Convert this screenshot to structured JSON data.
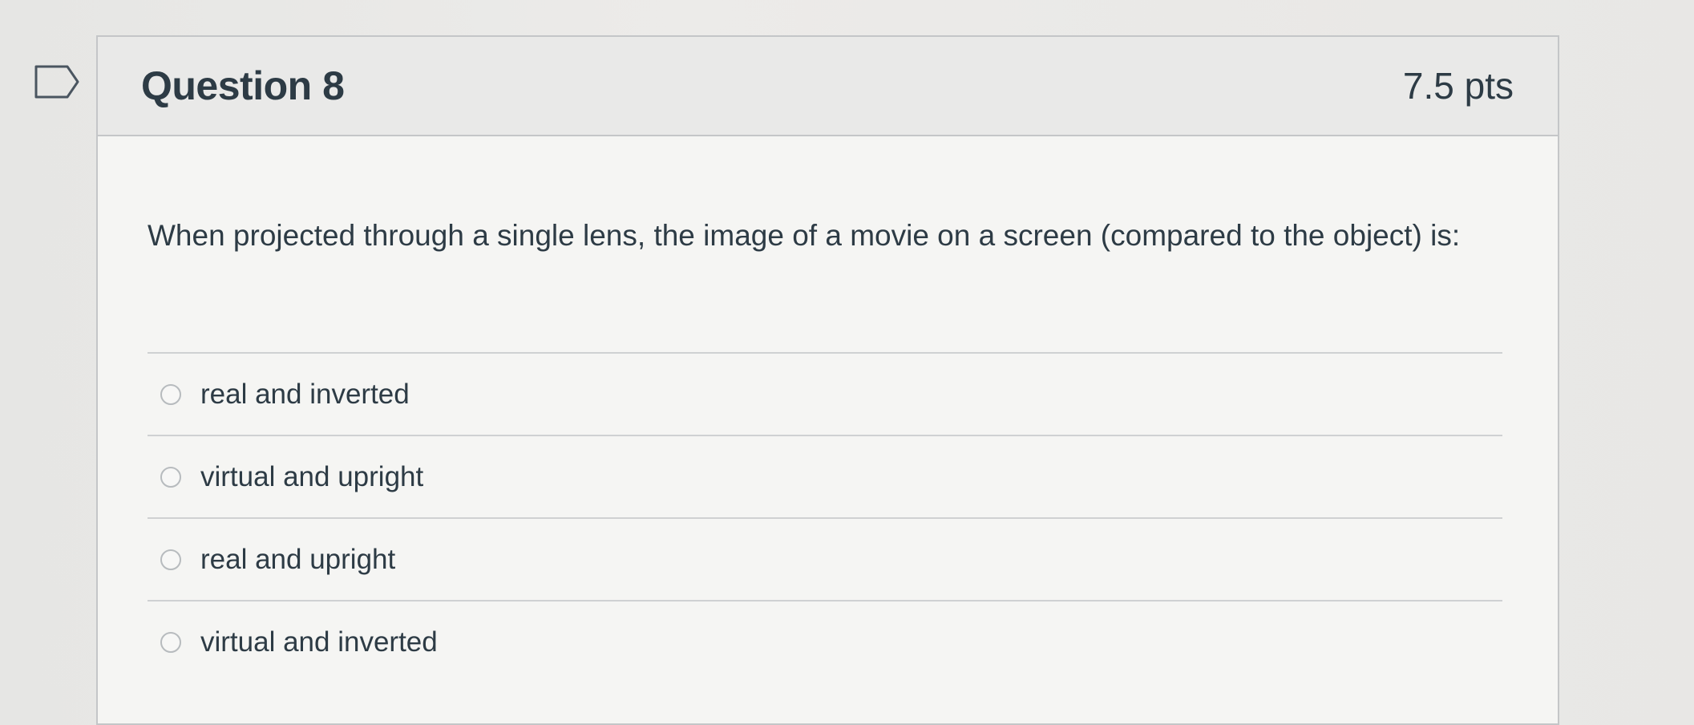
{
  "question": {
    "title": "Question 8",
    "points": "7.5 pts",
    "text": "When projected through a single lens, the image of a movie on a screen (compared to the object) is:"
  },
  "answers": [
    {
      "label": "real and inverted",
      "selected": false
    },
    {
      "label": "virtual and upright",
      "selected": false
    },
    {
      "label": "real and upright",
      "selected": false
    },
    {
      "label": "virtual and inverted",
      "selected": false
    }
  ],
  "icons": {
    "flag": "flag-question-icon"
  },
  "colors": {
    "text": "#2d3b45",
    "header_bg": "#e9e9e8",
    "card_bg": "#f5f5f3",
    "border": "#c4c6c8"
  }
}
